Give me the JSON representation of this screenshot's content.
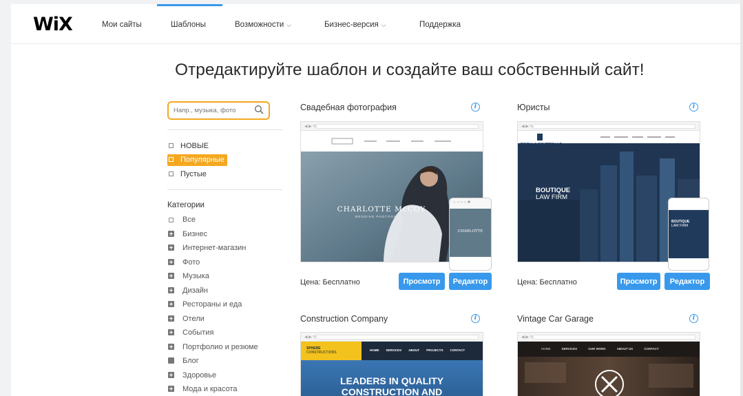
{
  "header": {
    "logo": "WiX",
    "nav": [
      {
        "label": "Мои сайты",
        "chevron": false
      },
      {
        "label": "Шаблоны",
        "chevron": false,
        "active": true
      },
      {
        "label": "Возможности",
        "chevron": true
      },
      {
        "label": "Бизнес-версия",
        "chevron": true
      },
      {
        "label": "Поддержка",
        "chevron": false
      }
    ]
  },
  "headline": "Отредактируйте шаблон и создайте ваш собственный сайт!",
  "sidebar": {
    "search_placeholder": "Напр., музыка, фото",
    "filters": [
      {
        "label": "НОВЫЕ",
        "selected": false
      },
      {
        "label": "Популярные",
        "selected": true
      },
      {
        "label": "Пустые",
        "selected": false
      }
    ],
    "categories_title": "Категории",
    "categories": [
      {
        "label": "Все",
        "icon": "checkbox"
      },
      {
        "label": "Бизнес",
        "icon": "plus"
      },
      {
        "label": "Интернет-магазин",
        "icon": "plus"
      },
      {
        "label": "Фото",
        "icon": "plus"
      },
      {
        "label": "Музыка",
        "icon": "plus"
      },
      {
        "label": "Дизайн",
        "icon": "plus"
      },
      {
        "label": "Рестораны и еда",
        "icon": "plus"
      },
      {
        "label": "Отели",
        "icon": "plus"
      },
      {
        "label": "События",
        "icon": "plus"
      },
      {
        "label": "Портфолио и резюме",
        "icon": "plus"
      },
      {
        "label": "Блог",
        "icon": "square"
      },
      {
        "label": "Здоровье",
        "icon": "plus"
      },
      {
        "label": "Мода и красота",
        "icon": "plus"
      }
    ]
  },
  "templates": [
    {
      "title": "Свадебная фотография",
      "price": "Цена: Бесплатно",
      "view_label": "Просмотр",
      "edit_label": "Редактор",
      "preview": {
        "name": "CHARLOTTE McCOY",
        "subtitle": "WEDDING PHOTOGRAPHY",
        "mobile_name": "CHARLOTTE"
      }
    },
    {
      "title": "Юристы",
      "price": "Цена: Бесплатно",
      "view_label": "Просмотр",
      "edit_label": "Редактор",
      "preview": {
        "brand": "BINGLL & WALTERS LLP",
        "heading1": "BOUTIQUE",
        "heading2": "LAW FIRM",
        "mobile_heading1": "BOUTIQUE",
        "mobile_heading2": "LAW FIRM"
      }
    },
    {
      "title": "Construction Company",
      "preview": {
        "brand1": "SPHERE",
        "brand2": "CONSTRUCTIONS",
        "menu": [
          "HOME",
          "SERVICES",
          "ABOUT",
          "PROJECTS",
          "CONTACT"
        ],
        "heading1": "LEADERS IN QUALITY",
        "heading2": "CONSTRUCTION AND"
      }
    },
    {
      "title": "Vintage Car Garage",
      "preview": {
        "menu": [
          "HOME",
          "SERVICES",
          "OUR WORK",
          "ABOUT US",
          "CONTACT"
        ]
      }
    }
  ],
  "colors": {
    "accent": "#3899ec",
    "highlight": "#f5a81f",
    "wedding_bg": "#6f8796",
    "law_bg": "#223a5a",
    "construction_hero": "#2f6aa6",
    "garage_bg": "#2b2420"
  }
}
